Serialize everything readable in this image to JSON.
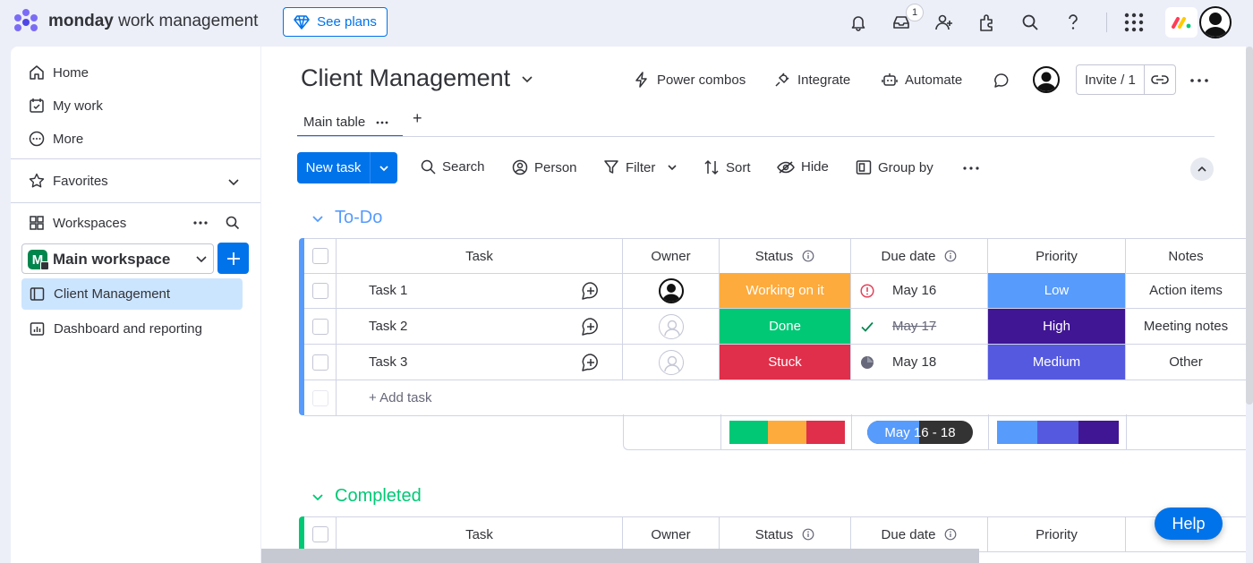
{
  "app": {
    "logo_brand": "monday",
    "logo_product": " work management",
    "see_plans_label": "See plans",
    "inbox_badge": "1",
    "colors": {
      "accent": "#0073ea",
      "logo_red": "#ff3d57",
      "logo_yellow": "#ffcb00",
      "logo_green": "#00ca72",
      "logo_purple": "#a25ddc"
    }
  },
  "sidebar": {
    "nav": [
      {
        "label": "Home",
        "icon": "home-icon"
      },
      {
        "label": "My work",
        "icon": "calendar-check-icon"
      },
      {
        "label": "More",
        "icon": "more-circle-icon"
      }
    ],
    "favorites_label": "Favorites",
    "workspaces_label": "Workspaces",
    "workspace": {
      "initial": "M",
      "name": "Main workspace"
    },
    "boards": [
      {
        "label": "Client Management",
        "icon": "board-icon",
        "active": true
      },
      {
        "label": "Dashboard and reporting",
        "icon": "dashboard-icon",
        "active": false
      }
    ]
  },
  "board": {
    "title": "Client Management",
    "actions": {
      "power_combos": "Power combos",
      "integrate": "Integrate",
      "automate": "Automate"
    },
    "invite_label": "Invite / 1",
    "tabs": [
      {
        "label": "Main table"
      }
    ],
    "tab_add_label": "+",
    "toolbar": {
      "new_task": "New task",
      "search": "Search",
      "person": "Person",
      "filter": "Filter",
      "sort": "Sort",
      "hide": "Hide",
      "group_by": "Group by"
    }
  },
  "columns": {
    "task": "Task",
    "owner": "Owner",
    "status": "Status",
    "due_date": "Due date",
    "priority": "Priority",
    "notes": "Notes"
  },
  "groups": {
    "todo": {
      "title": "To-Do",
      "color": "#579bfc",
      "rows": [
        {
          "task": "Task 1",
          "owner": "filled-avatar",
          "status": "Working on it",
          "status_color": "#fdab3d",
          "due_icon": "alert-icon",
          "due": "May 16",
          "priority": "Low",
          "priority_color": "#579bfc",
          "notes": "Action items"
        },
        {
          "task": "Task 2",
          "owner": "empty-avatar",
          "status": "Done",
          "status_color": "#00c875",
          "due_icon": "check-icon",
          "due": "May 17",
          "priority": "High",
          "priority_color": "#401694",
          "notes": "Meeting notes"
        },
        {
          "task": "Task 3",
          "owner": "empty-avatar",
          "status": "Stuck",
          "status_color": "#df2f4a",
          "due_icon": "clock-icon",
          "due": "May 18",
          "priority": "Medium",
          "priority_color": "#5559df",
          "notes": "Other"
        }
      ],
      "add_task_label": "+ Add task",
      "summary": {
        "status_segments": [
          {
            "color": "#00c875",
            "fraction": 0.3333
          },
          {
            "color": "#fdab3d",
            "fraction": 0.3333
          },
          {
            "color": "#df2f4a",
            "fraction": 0.3334
          }
        ],
        "date_range_a": "May 1",
        "date_range_b": "6 - 18",
        "priority_segments": [
          {
            "color": "#579bfc",
            "fraction": 0.3333
          },
          {
            "color": "#5559df",
            "fraction": 0.3333
          },
          {
            "color": "#401694",
            "fraction": 0.3334
          }
        ]
      }
    },
    "completed": {
      "title": "Completed",
      "color": "#00c875"
    }
  },
  "help_label": "Help"
}
